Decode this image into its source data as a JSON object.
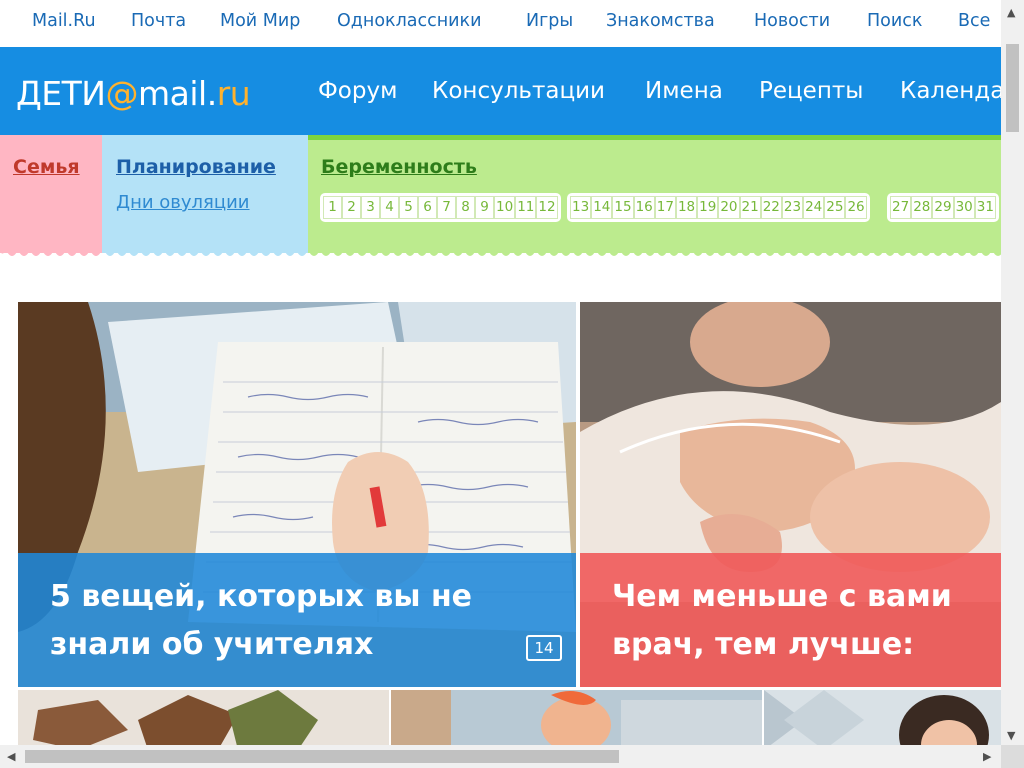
{
  "portal_nav": [
    {
      "label": "Mail.Ru"
    },
    {
      "label": "Почта"
    },
    {
      "label": "Мой Мир"
    },
    {
      "label": "Одноклассники"
    },
    {
      "label": "Игры"
    },
    {
      "label": "Знакомства"
    },
    {
      "label": "Новости"
    },
    {
      "label": "Поиск"
    },
    {
      "label": "Все"
    }
  ],
  "logo": {
    "deti": "ДЕТИ",
    "at": "@",
    "mail": "mail",
    "dot": ".",
    "ru": "ru"
  },
  "header_nav": [
    {
      "label": "Форум"
    },
    {
      "label": "Консультации"
    },
    {
      "label": "Имена"
    },
    {
      "label": "Рецепты"
    },
    {
      "label": "Календа"
    }
  ],
  "categories": {
    "semya": {
      "label": "Семья",
      "color": "#c0392b"
    },
    "planirovanie": {
      "label": "Планирование",
      "color": "#1d5fa8",
      "sub": "Дни овуляции"
    },
    "beremennost": {
      "label": "Беременность",
      "color": "#2e7d1a"
    }
  },
  "weeks": {
    "group1": [
      "1",
      "2",
      "3",
      "4",
      "5",
      "6",
      "7",
      "8",
      "9",
      "10",
      "11",
      "12"
    ],
    "group2": [
      "13",
      "14",
      "15",
      "16",
      "17",
      "18",
      "19",
      "20",
      "21",
      "22",
      "23",
      "24",
      "25",
      "26"
    ],
    "group3": [
      "27",
      "28",
      "29",
      "30",
      "31"
    ]
  },
  "cards": [
    {
      "title": "5 вещей, которых вы не знали об учителях",
      "comments": "14",
      "overlay_color": "#1f88d8"
    },
    {
      "title": "Чем меньше с вами врач, тем лучше:",
      "overlay_color": "#f05a5a"
    }
  ],
  "colors": {
    "brand_blue": "#168de2",
    "accent_orange": "#ffb22e",
    "green": "#7ed43d"
  }
}
